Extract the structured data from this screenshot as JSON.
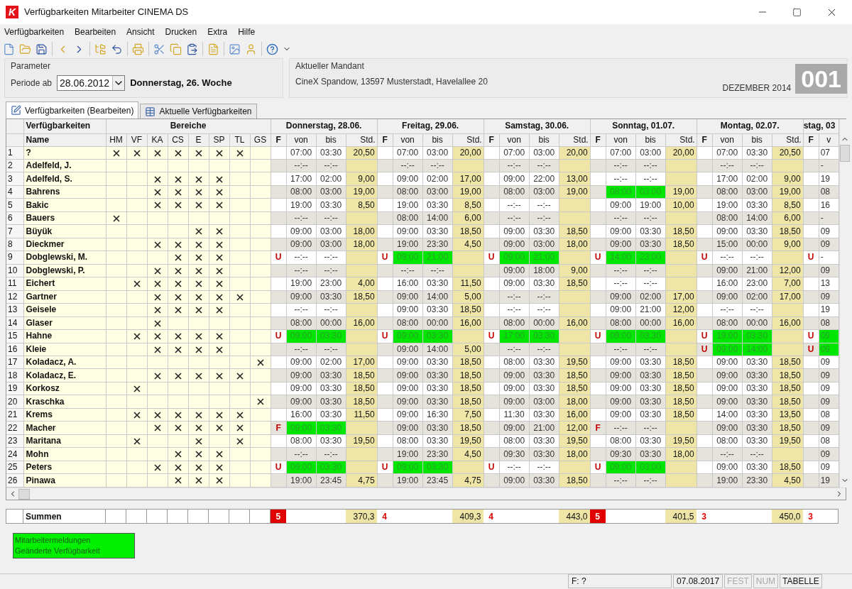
{
  "window": {
    "logo": "K",
    "title": "Verfügbarkeiten Mitarbeiter CINEMA DS"
  },
  "menu": [
    "Verfügbarkeiten",
    "Bearbeiten",
    "Ansicht",
    "Drucken",
    "Extra",
    "Hilfe"
  ],
  "parameter": {
    "title": "Parameter",
    "label": "Periode ab",
    "date": "28.06.2012",
    "weekday": "Donnerstag, 26. Woche"
  },
  "mandant": {
    "title": "Aktueller Mandant",
    "address": "CineX Spandow, 13597 Musterstadt, Havelallee 20",
    "month": "DEZEMBER 2014",
    "number": "001"
  },
  "tabs": [
    {
      "label": "Verfügbarkeiten (Bearbeiten)",
      "selected": true
    },
    {
      "label": "Aktuelle Verfügbarkeiten",
      "selected": false
    }
  ],
  "table": {
    "group_title": "Verfügbarkeiten",
    "areas_title": "Bereiche",
    "name_header": "Name",
    "areas": [
      "HM",
      "VF",
      "KA",
      "CS",
      "E",
      "SP",
      "TL",
      "GS"
    ],
    "days": [
      {
        "title": "Donnerstag, 28.06.",
        "columns": [
          "F",
          "von",
          "bis",
          "Std."
        ]
      },
      {
        "title": "Freitag, 29.06.",
        "columns": [
          "F",
          "von",
          "bis",
          "Std."
        ]
      },
      {
        "title": "Samstag, 30.06.",
        "columns": [
          "F",
          "von",
          "bis",
          "Std."
        ]
      },
      {
        "title": "Sonntag, 01.07.",
        "columns": [
          "F",
          "von",
          "bis",
          "Std."
        ]
      },
      {
        "title": "Montag, 02.07.",
        "columns": [
          "F",
          "von",
          "bis",
          "Std."
        ]
      }
    ],
    "partial_day": {
      "title": "stag, 03",
      "columns": [
        "F",
        "v"
      ]
    },
    "rows": [
      {
        "number": "1",
        "name": "?",
        "areas": [
          true,
          true,
          true,
          true,
          true,
          true,
          true,
          false
        ],
        "days": [
          {
            "von": "07:00",
            "bis": "03:30",
            "std": "20,50",
            "highlighted": false
          },
          {
            "von": "07:00",
            "bis": "03:00",
            "std": "20,00",
            "highlighted": false
          },
          {
            "von": "07:00",
            "bis": "03:00",
            "std": "20,00",
            "highlighted": false
          },
          {
            "von": "07:00",
            "bis": "03:00",
            "std": "20,00",
            "highlighted": false
          },
          {
            "von": "07:00",
            "bis": "03:30",
            "std": "20,50",
            "highlighted": false
          }
        ],
        "partial": {
          "von": "07",
          "highlighted": false
        }
      },
      {
        "number": "2",
        "name": "Adelfeld, J.",
        "areas": [
          false,
          false,
          false,
          false,
          false,
          false,
          false,
          false
        ],
        "days": [
          {
            "von": "--:--",
            "bis": "--:--",
            "highlighted": false
          },
          {
            "von": "--:--",
            "bis": "--:--",
            "highlighted": false
          },
          {
            "von": "--:--",
            "bis": "--:--",
            "highlighted": false
          },
          {
            "von": "--:--",
            "bis": "--:--",
            "highlighted": false
          },
          {
            "von": "--:--",
            "bis": "--:--",
            "highlighted": false
          }
        ],
        "partial": {
          "von": "-",
          "highlighted": false
        }
      },
      {
        "number": "3",
        "name": "Adelfeld, S.",
        "areas": [
          false,
          false,
          true,
          true,
          true,
          true,
          false,
          false
        ],
        "days": [
          {
            "von": "17:00",
            "bis": "02:00",
            "std": "9,00",
            "highlighted": false
          },
          {
            "von": "09:00",
            "bis": "02:00",
            "std": "17,00",
            "highlighted": false
          },
          {
            "von": "09:00",
            "bis": "22:00",
            "std": "13,00",
            "highlighted": false
          },
          {
            "von": "--:--",
            "bis": "--:--",
            "highlighted": false
          },
          {
            "von": "17:00",
            "bis": "02:00",
            "std": "9,00",
            "highlighted": false
          }
        ],
        "partial": {
          "von": "19",
          "highlighted": false
        }
      },
      {
        "number": "4",
        "name": "Bahrens",
        "areas": [
          false,
          false,
          true,
          true,
          true,
          true,
          false,
          false
        ],
        "days": [
          {
            "von": "08:00",
            "bis": "03:00",
            "std": "19,00",
            "highlighted": false
          },
          {
            "von": "08:00",
            "bis": "03:00",
            "std": "19,00",
            "highlighted": false
          },
          {
            "von": "08:00",
            "bis": "03:00",
            "std": "19,00",
            "highlighted": false
          },
          {
            "von": "08:00",
            "bis": "03:00",
            "std": "19,00",
            "highlighted": true
          },
          {
            "von": "08:00",
            "bis": "03:00",
            "std": "19,00",
            "highlighted": false
          }
        ],
        "partial": {
          "von": "08",
          "highlighted": false
        }
      },
      {
        "number": "5",
        "name": "Bakic",
        "areas": [
          false,
          false,
          true,
          true,
          true,
          true,
          false,
          false
        ],
        "days": [
          {
            "von": "19:00",
            "bis": "03:30",
            "std": "8,50",
            "highlighted": false
          },
          {
            "von": "19:00",
            "bis": "03:30",
            "std": "8,50",
            "highlighted": false
          },
          {
            "von": "--:--",
            "bis": "--:--",
            "highlighted": false
          },
          {
            "von": "09:00",
            "bis": "19:00",
            "std": "10,00",
            "highlighted": false
          },
          {
            "von": "19:00",
            "bis": "03:30",
            "std": "8,50",
            "highlighted": false
          }
        ],
        "partial": {
          "von": "16",
          "highlighted": false
        }
      },
      {
        "number": "6",
        "name": "Bauers",
        "areas": [
          true,
          false,
          false,
          false,
          false,
          false,
          false,
          false
        ],
        "days": [
          {
            "von": "--:--",
            "bis": "--:--",
            "highlighted": false
          },
          {
            "von": "08:00",
            "bis": "14:00",
            "std": "6,00",
            "highlighted": false
          },
          {
            "von": "--:--",
            "bis": "--:--",
            "highlighted": false
          },
          {
            "von": "--:--",
            "bis": "--:--",
            "highlighted": false
          },
          {
            "von": "08:00",
            "bis": "14:00",
            "std": "6,00",
            "highlighted": false
          }
        ],
        "partial": {
          "von": "-",
          "highlighted": false
        }
      },
      {
        "number": "7",
        "name": "Büyük",
        "areas": [
          false,
          false,
          false,
          false,
          true,
          true,
          false,
          false
        ],
        "days": [
          {
            "von": "09:00",
            "bis": "03:00",
            "std": "18,00",
            "highlighted": false
          },
          {
            "von": "09:00",
            "bis": "03:30",
            "std": "18,50",
            "highlighted": false
          },
          {
            "von": "09:00",
            "bis": "03:30",
            "std": "18,50",
            "highlighted": false
          },
          {
            "von": "09:00",
            "bis": "03:30",
            "std": "18,50",
            "highlighted": false
          },
          {
            "von": "09:00",
            "bis": "03:30",
            "std": "18,50",
            "highlighted": false
          }
        ],
        "partial": {
          "von": "09",
          "highlighted": false
        }
      },
      {
        "number": "8",
        "name": "Dieckmer",
        "areas": [
          false,
          false,
          true,
          true,
          true,
          true,
          false,
          false
        ],
        "days": [
          {
            "von": "09:00",
            "bis": "03:00",
            "std": "18,00",
            "highlighted": false
          },
          {
            "von": "19:00",
            "bis": "23:30",
            "std": "4,50",
            "highlighted": false
          },
          {
            "von": "09:00",
            "bis": "03:00",
            "std": "18,00",
            "highlighted": false
          },
          {
            "von": "09:00",
            "bis": "03:30",
            "std": "18,50",
            "highlighted": false
          },
          {
            "von": "15:00",
            "bis": "00:00",
            "std": "9,00",
            "highlighted": false
          }
        ],
        "partial": {
          "von": "09",
          "highlighted": false
        }
      },
      {
        "number": "9",
        "name": "Dobglewski, M.",
        "areas": [
          false,
          false,
          false,
          true,
          true,
          true,
          false,
          false
        ],
        "days": [
          {
            "f": "U",
            "von": "--:--",
            "bis": "--:--",
            "highlighted": false
          },
          {
            "f": "U",
            "von": "09:00",
            "bis": "21:00",
            "highlighted": true
          },
          {
            "f": "U",
            "von": "09:00",
            "bis": "21:00",
            "highlighted": true
          },
          {
            "f": "U",
            "von": "14:00",
            "bis": "23:00",
            "highlighted": true
          },
          {
            "f": "U",
            "von": "--:--",
            "bis": "--:--",
            "highlighted": false
          }
        ],
        "partial": {
          "f": "U",
          "von": "-",
          "highlighted": false
        }
      },
      {
        "number": "10",
        "name": "Dobglewski, P.",
        "areas": [
          false,
          false,
          true,
          true,
          true,
          true,
          false,
          false
        ],
        "days": [
          {
            "von": "--:--",
            "bis": "--:--",
            "highlighted": false
          },
          {
            "von": "--:--",
            "bis": "--:--",
            "highlighted": false
          },
          {
            "von": "09:00",
            "bis": "18:00",
            "std": "9,00",
            "highlighted": false
          },
          {
            "von": "--:--",
            "bis": "--:--",
            "highlighted": false
          },
          {
            "von": "09:00",
            "bis": "21:00",
            "std": "12,00",
            "highlighted": false
          }
        ],
        "partial": {
          "von": "09",
          "highlighted": false
        }
      },
      {
        "number": "11",
        "name": "Eichert",
        "areas": [
          false,
          true,
          true,
          true,
          true,
          true,
          false,
          false
        ],
        "days": [
          {
            "von": "19:00",
            "bis": "23:00",
            "std": "4,00",
            "highlighted": false
          },
          {
            "von": "16:00",
            "bis": "03:30",
            "std": "11,50",
            "highlighted": false
          },
          {
            "von": "09:00",
            "bis": "03:30",
            "std": "18,50",
            "highlighted": false
          },
          {
            "von": "--:--",
            "bis": "--:--",
            "highlighted": false
          },
          {
            "von": "16:00",
            "bis": "23:00",
            "std": "7,00",
            "highlighted": false
          }
        ],
        "partial": {
          "von": "13",
          "highlighted": false
        }
      },
      {
        "number": "12",
        "name": "Gartner",
        "areas": [
          false,
          false,
          true,
          true,
          true,
          true,
          true,
          false
        ],
        "days": [
          {
            "von": "09:00",
            "bis": "03:30",
            "std": "18,50",
            "highlighted": false
          },
          {
            "von": "09:00",
            "bis": "14:00",
            "std": "5,00",
            "highlighted": false
          },
          {
            "von": "--:--",
            "bis": "--:--",
            "highlighted": false
          },
          {
            "von": "09:00",
            "bis": "02:00",
            "std": "17,00",
            "highlighted": false
          },
          {
            "von": "09:00",
            "bis": "02:00",
            "std": "17,00",
            "highlighted": false
          }
        ],
        "partial": {
          "von": "09",
          "highlighted": false
        }
      },
      {
        "number": "13",
        "name": "Geisele",
        "areas": [
          false,
          false,
          true,
          true,
          true,
          true,
          false,
          false
        ],
        "days": [
          {
            "von": "--:--",
            "bis": "--:--",
            "highlighted": false
          },
          {
            "von": "09:00",
            "bis": "03:30",
            "std": "18,50",
            "highlighted": false
          },
          {
            "von": "--:--",
            "bis": "--:--",
            "highlighted": false
          },
          {
            "von": "09:00",
            "bis": "21:00",
            "std": "12,00",
            "highlighted": false
          },
          {
            "von": "--:--",
            "bis": "--:--",
            "highlighted": false
          }
        ],
        "partial": {
          "von": "19",
          "highlighted": false
        }
      },
      {
        "number": "14",
        "name": "Glaser",
        "areas": [
          false,
          false,
          true,
          false,
          false,
          false,
          false,
          false
        ],
        "days": [
          {
            "von": "08:00",
            "bis": "00:00",
            "std": "16,00",
            "highlighted": false
          },
          {
            "von": "08:00",
            "bis": "00:00",
            "std": "16,00",
            "highlighted": false
          },
          {
            "von": "08:00",
            "bis": "00:00",
            "std": "16,00",
            "highlighted": false
          },
          {
            "von": "08:00",
            "bis": "00:00",
            "std": "16,00",
            "highlighted": false
          },
          {
            "von": "08:00",
            "bis": "00:00",
            "std": "16,00",
            "highlighted": false
          }
        ],
        "partial": {
          "von": "08",
          "highlighted": false
        }
      },
      {
        "number": "15",
        "name": "Hahne",
        "areas": [
          false,
          true,
          true,
          true,
          true,
          true,
          false,
          false
        ],
        "days": [
          {
            "f": "U",
            "von": "09:00",
            "bis": "03:30",
            "highlighted": true
          },
          {
            "f": "U",
            "von": "09:00",
            "bis": "03:30",
            "highlighted": true
          },
          {
            "f": "U",
            "von": "17:00",
            "bis": "03:30",
            "highlighted": true
          },
          {
            "f": "U",
            "von": "09:00",
            "bis": "03:30",
            "highlighted": true
          },
          {
            "f": "U",
            "von": "19:00",
            "bis": "03:30",
            "highlighted": true
          }
        ],
        "partial": {
          "f": "U",
          "von": "09",
          "highlighted": true
        }
      },
      {
        "number": "16",
        "name": "Kleie",
        "areas": [
          false,
          false,
          true,
          true,
          true,
          true,
          false,
          false
        ],
        "days": [
          {
            "von": "--:--",
            "bis": "--:--",
            "highlighted": false
          },
          {
            "von": "09:00",
            "bis": "14:00",
            "std": "5,00",
            "highlighted": false
          },
          {
            "von": "--:--",
            "bis": "--:--",
            "highlighted": false
          },
          {
            "von": "--:--",
            "bis": "--:--",
            "highlighted": false
          },
          {
            "f": "U",
            "von": "09:00",
            "bis": "14:00",
            "highlighted": true
          }
        ],
        "partial": {
          "f": "U",
          "von": "09",
          "highlighted": true
        }
      },
      {
        "number": "17",
        "name": "Koladacz, A.",
        "areas": [
          false,
          false,
          false,
          false,
          false,
          false,
          false,
          true
        ],
        "days": [
          {
            "von": "09:00",
            "bis": "02:00",
            "std": "17,00",
            "highlighted": false
          },
          {
            "von": "09:00",
            "bis": "03:30",
            "std": "18,50",
            "highlighted": false
          },
          {
            "von": "08:00",
            "bis": "03:30",
            "std": "19,50",
            "highlighted": false
          },
          {
            "von": "09:00",
            "bis": "03:30",
            "std": "18,50",
            "highlighted": false
          },
          {
            "von": "09:00",
            "bis": "03:30",
            "std": "18,50",
            "highlighted": false
          }
        ],
        "partial": {
          "von": "09",
          "highlighted": false
        }
      },
      {
        "number": "18",
        "name": "Koladacz, E.",
        "areas": [
          false,
          false,
          true,
          true,
          true,
          true,
          true,
          false
        ],
        "days": [
          {
            "von": "09:00",
            "bis": "03:30",
            "std": "18,50",
            "highlighted": false
          },
          {
            "von": "09:00",
            "bis": "03:30",
            "std": "18,50",
            "highlighted": false
          },
          {
            "von": "09:00",
            "bis": "03:30",
            "std": "18,50",
            "highlighted": false
          },
          {
            "von": "09:00",
            "bis": "03:30",
            "std": "18,50",
            "highlighted": false
          },
          {
            "von": "09:00",
            "bis": "03:30",
            "std": "18,50",
            "highlighted": false
          }
        ],
        "partial": {
          "von": "09",
          "highlighted": false
        }
      },
      {
        "number": "19",
        "name": "Korkosz",
        "areas": [
          false,
          true,
          false,
          false,
          false,
          false,
          false,
          false
        ],
        "days": [
          {
            "von": "09:00",
            "bis": "03:30",
            "std": "18,50",
            "highlighted": false
          },
          {
            "von": "09:00",
            "bis": "03:30",
            "std": "18,50",
            "highlighted": false
          },
          {
            "von": "09:00",
            "bis": "03:30",
            "std": "18,50",
            "highlighted": false
          },
          {
            "von": "09:00",
            "bis": "03:30",
            "std": "18,50",
            "highlighted": false
          },
          {
            "von": "09:00",
            "bis": "03:30",
            "std": "18,50",
            "highlighted": false
          }
        ],
        "partial": {
          "von": "09",
          "highlighted": false
        }
      },
      {
        "number": "20",
        "name": "Kraschka",
        "areas": [
          false,
          false,
          false,
          false,
          false,
          false,
          false,
          true
        ],
        "days": [
          {
            "von": "09:00",
            "bis": "03:30",
            "std": "18,50",
            "highlighted": false
          },
          {
            "von": "09:00",
            "bis": "03:30",
            "std": "18,50",
            "highlighted": false
          },
          {
            "von": "09:00",
            "bis": "03:00",
            "std": "18,00",
            "highlighted": false
          },
          {
            "von": "09:00",
            "bis": "03:30",
            "std": "18,50",
            "highlighted": false
          },
          {
            "von": "09:00",
            "bis": "03:30",
            "std": "18,50",
            "highlighted": false
          }
        ],
        "partial": {
          "von": "09",
          "highlighted": false
        }
      },
      {
        "number": "21",
        "name": "Krems",
        "areas": [
          false,
          true,
          true,
          true,
          true,
          true,
          true,
          false
        ],
        "days": [
          {
            "von": "16:00",
            "bis": "03:30",
            "std": "11,50",
            "highlighted": false
          },
          {
            "von": "09:00",
            "bis": "16:30",
            "std": "7,50",
            "highlighted": false
          },
          {
            "von": "11:30",
            "bis": "03:30",
            "std": "16,00",
            "highlighted": false
          },
          {
            "von": "09:00",
            "bis": "03:30",
            "std": "18,50",
            "highlighted": false
          },
          {
            "von": "14:00",
            "bis": "03:30",
            "std": "13,50",
            "highlighted": false
          }
        ],
        "partial": {
          "von": "08",
          "highlighted": false
        }
      },
      {
        "number": "22",
        "name": "Macher",
        "areas": [
          false,
          false,
          true,
          true,
          true,
          true,
          true,
          false
        ],
        "days": [
          {
            "f": "F",
            "von": "09:00",
            "bis": "03:30",
            "highlighted": true
          },
          {
            "von": "09:00",
            "bis": "03:30",
            "std": "18,50",
            "highlighted": false
          },
          {
            "von": "09:00",
            "bis": "21:00",
            "std": "12,00",
            "highlighted": false
          },
          {
            "f": "F",
            "von": "--:--",
            "bis": "--:--",
            "highlighted": false
          },
          {
            "von": "09:00",
            "bis": "03:30",
            "std": "18,50",
            "highlighted": false
          }
        ],
        "partial": {
          "von": "09",
          "highlighted": false
        }
      },
      {
        "number": "23",
        "name": "Maritana",
        "areas": [
          false,
          true,
          false,
          false,
          true,
          false,
          true,
          false
        ],
        "days": [
          {
            "von": "08:00",
            "bis": "03:30",
            "std": "19,50",
            "highlighted": false
          },
          {
            "von": "08:00",
            "bis": "03:30",
            "std": "19,50",
            "highlighted": false
          },
          {
            "von": "08:00",
            "bis": "03:30",
            "std": "19,50",
            "highlighted": false
          },
          {
            "von": "08:00",
            "bis": "03:30",
            "std": "19,50",
            "highlighted": false
          },
          {
            "von": "08:00",
            "bis": "03:30",
            "std": "19,50",
            "highlighted": false
          }
        ],
        "partial": {
          "von": "08",
          "highlighted": false
        }
      },
      {
        "number": "24",
        "name": "Mohn",
        "areas": [
          false,
          false,
          false,
          true,
          true,
          true,
          false,
          false
        ],
        "days": [
          {
            "von": "--:--",
            "bis": "--:--",
            "highlighted": false
          },
          {
            "von": "19:00",
            "bis": "23:30",
            "std": "4,50",
            "highlighted": false
          },
          {
            "von": "09:30",
            "bis": "03:30",
            "std": "18,00",
            "highlighted": false
          },
          {
            "von": "09:30",
            "bis": "03:30",
            "std": "18,00",
            "highlighted": false
          },
          {
            "von": "--:--",
            "bis": "--:--",
            "highlighted": false
          }
        ],
        "partial": {
          "von": "09",
          "highlighted": false
        }
      },
      {
        "number": "25",
        "name": "Peters",
        "areas": [
          false,
          false,
          true,
          true,
          true,
          true,
          false,
          false
        ],
        "days": [
          {
            "f": "U",
            "von": "09:00",
            "bis": "03:30",
            "highlighted": true
          },
          {
            "f": "U",
            "von": "09:00",
            "bis": "03:30",
            "highlighted": true
          },
          {
            "f": "U",
            "von": "--:--",
            "bis": "--:--",
            "highlighted": false
          },
          {
            "f": "U",
            "von": "09:00",
            "bis": "03:00",
            "highlighted": true
          },
          {
            "von": "09:00",
            "bis": "03:30",
            "std": "18,50",
            "highlighted": false
          }
        ],
        "partial": {
          "von": "09",
          "highlighted": false
        }
      },
      {
        "number": "26",
        "name": "Pinawa",
        "areas": [
          false,
          false,
          false,
          true,
          true,
          true,
          false,
          false
        ],
        "days": [
          {
            "von": "19:00",
            "bis": "23:45",
            "std": "4,75",
            "highlighted": false
          },
          {
            "von": "19:00",
            "bis": "23:45",
            "std": "4,75",
            "highlighted": false
          },
          {
            "von": "09:00",
            "bis": "03:30",
            "std": "18,50",
            "highlighted": false
          },
          {
            "von": "--:--",
            "bis": "--:--",
            "highlighted": false
          },
          {
            "von": "19:00",
            "bis": "23:30",
            "std": "4,50",
            "highlighted": false
          }
        ],
        "partial": {
          "von": "19",
          "highlighted": false
        }
      }
    ]
  },
  "sums": {
    "label": "Summen",
    "days": [
      {
        "count": "5",
        "alert": true,
        "total": "370,3"
      },
      {
        "count": "4",
        "alert": false,
        "total": "409,3"
      },
      {
        "count": "4",
        "alert": false,
        "total": "443,0"
      },
      {
        "count": "5",
        "alert": true,
        "total": "401,5"
      },
      {
        "count": "3",
        "alert": false,
        "total": "450,0"
      }
    ],
    "partial": {
      "count": "3",
      "alert": false
    }
  },
  "legend": [
    "Mitarbeitermeldungen",
    "Geänderte Verfügbarkeit"
  ],
  "status_bar": {
    "field": "F: ?",
    "date": "07.08.2017",
    "indicators": [
      {
        "label": "FEST",
        "active": false
      },
      {
        "label": "NUM",
        "active": false
      },
      {
        "label": "TABELLE",
        "active": true
      }
    ]
  }
}
